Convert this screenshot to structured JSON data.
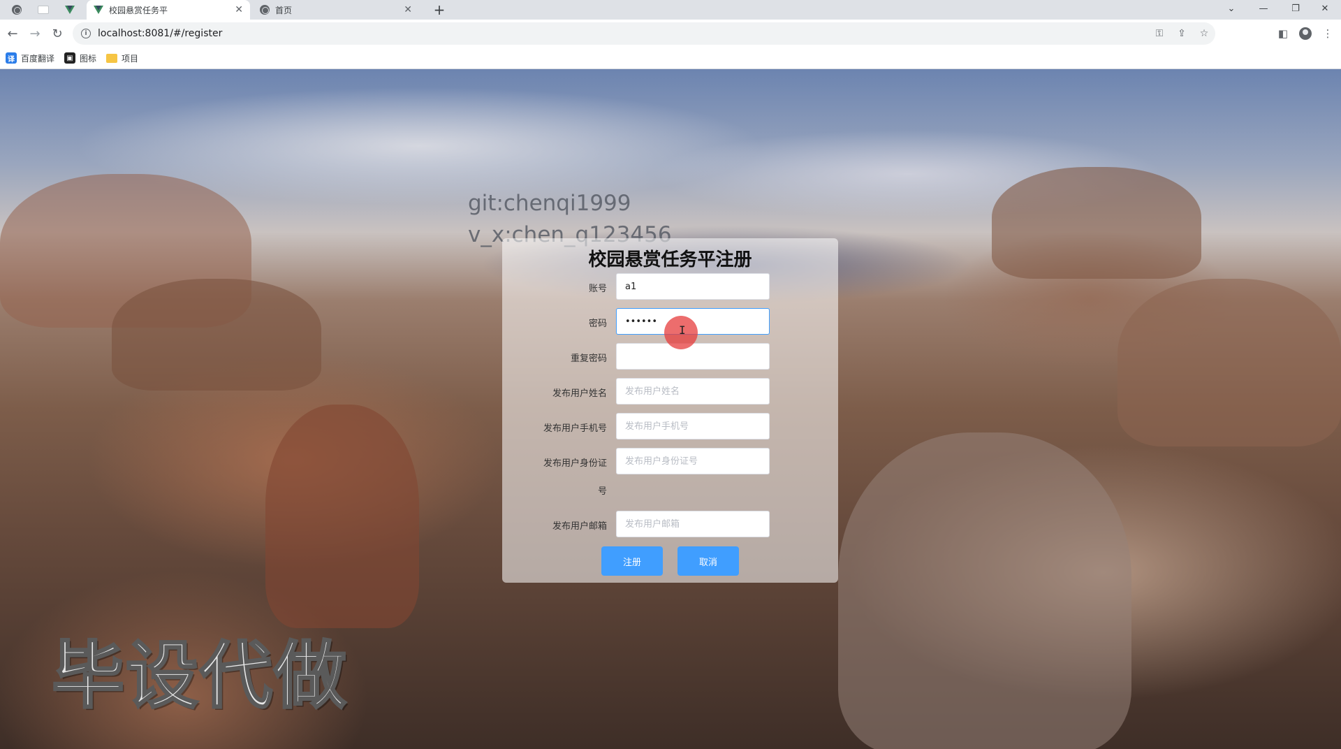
{
  "browser": {
    "tabs": [
      {
        "title": "校园悬赏任务平",
        "active": true
      },
      {
        "title": "首页",
        "active": false
      }
    ],
    "new_tab_symbol": "+",
    "url": "localhost:8081/#/register",
    "bookmarks": [
      {
        "label": "百度翻译",
        "icon": "translate-icon"
      },
      {
        "label": "图标",
        "icon": "iconfont-icon"
      },
      {
        "label": "项目",
        "icon": "folder-icon"
      }
    ]
  },
  "watermarks": {
    "git": "git:chenqi1999",
    "vx": "v_x:chen_q123456",
    "big": "毕设代做"
  },
  "form": {
    "title": "校园悬赏任务平注册",
    "fields": [
      {
        "label": "账号",
        "value": "a1",
        "placeholder": ""
      },
      {
        "label": "密码",
        "value": "••••••",
        "placeholder": ""
      },
      {
        "label": "重复密码",
        "value": "",
        "placeholder": ""
      },
      {
        "label": "发布用户姓名",
        "value": "",
        "placeholder": "发布用户姓名"
      },
      {
        "label": "发布用户手机号",
        "value": "",
        "placeholder": "发布用户手机号"
      },
      {
        "label": "发布用户身份证",
        "label_line2": "号",
        "value": "",
        "placeholder": "发布用户身份证号"
      },
      {
        "label": "发布用户邮箱",
        "value": "",
        "placeholder": "发布用户邮箱"
      }
    ],
    "submit_label": "注册",
    "cancel_label": "取消"
  },
  "colors": {
    "primary": "#409eff",
    "panel": "rgba(255,255,255,0.55)"
  }
}
